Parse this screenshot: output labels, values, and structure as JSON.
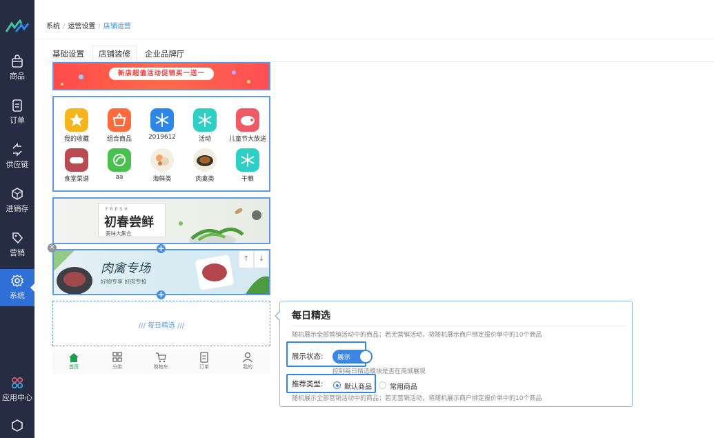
{
  "sidebar": {
    "logo": "logo",
    "items": [
      {
        "label": "商品",
        "icon": "bag-icon"
      },
      {
        "label": "订单",
        "icon": "document-icon"
      },
      {
        "label": "供应链",
        "icon": "exchange-icon"
      },
      {
        "label": "进销存",
        "icon": "box-icon"
      },
      {
        "label": "营销",
        "icon": "tag-icon"
      },
      {
        "label": "系统",
        "icon": "gear-icon",
        "active": true
      },
      {
        "label": "应用中心",
        "icon": "apps-icon"
      }
    ]
  },
  "breadcrumb": {
    "items": [
      "系统",
      "运营设置",
      "店铺运营"
    ]
  },
  "tabs": [
    {
      "label": "基础设置"
    },
    {
      "label": "店铺装修",
      "active": true
    },
    {
      "label": "企业品牌厅"
    }
  ],
  "preview": {
    "top_banner": "新店超值活动促销买一送一",
    "categories": [
      {
        "label": "我的收藏",
        "color": "#f5b51e",
        "icon": "star-icon"
      },
      {
        "label": "组合商品",
        "color": "#ff6b3d",
        "icon": "basket-icon"
      },
      {
        "label": "2019612",
        "color": "#2e86e8",
        "icon": "snowflake-icon"
      },
      {
        "label": "活动",
        "color": "#2ecfc5",
        "icon": "snowflake-icon"
      },
      {
        "label": "儿童节大放送",
        "color": "#ee5b66",
        "icon": "meat-icon"
      },
      {
        "label": "食堂菜谱",
        "color": "#b94a52",
        "icon": "sausage-icon"
      },
      {
        "label": "aa",
        "color": "#49c14f",
        "icon": "vegetable-icon"
      },
      {
        "label": "海鲜类",
        "color": "#f3ede2",
        "icon": "seafood-icon"
      },
      {
        "label": "肉禽类",
        "color": "#f4ece0",
        "icon": "meat-dish-icon"
      },
      {
        "label": "干粮",
        "color": "#2ecfc5",
        "icon": "snowflake-icon"
      }
    ],
    "fresh_banner": {
      "en": "FRESH",
      "title": "初春尝鲜",
      "subtitle": "美味大集合"
    },
    "meat_banner": {
      "title": "肉禽专场",
      "subtitle": "好物专享 好肉专抢"
    },
    "move_up": "↑",
    "move_down": "↓",
    "daily_placeholder": "///   每日精选   ///",
    "tabbar": [
      {
        "label": "首页",
        "icon": "home-icon",
        "active": true
      },
      {
        "label": "分类",
        "icon": "grid-icon"
      },
      {
        "label": "购物车",
        "icon": "cart-icon"
      },
      {
        "label": "订单",
        "icon": "list-icon"
      },
      {
        "label": "我的",
        "icon": "user-icon"
      }
    ]
  },
  "panel": {
    "title": "每日精选",
    "description": "随机展示全部营销活动中的商品；若无营销活动，将随机展示商户绑定报价单中的10个商品",
    "display_label": "展示状态:",
    "display_value": "展示",
    "display_on": true,
    "display_hint": "控制每日精选模块是否在商城展现",
    "type_label": "推荐类型:",
    "type_options": [
      {
        "label": "默认商品",
        "selected": true
      },
      {
        "label": "常用商品",
        "selected": false
      }
    ],
    "type_hint": "随机展示全部营销活动中的商品；若无营销活动，将随机展示商户绑定报价单中的10个商品"
  }
}
